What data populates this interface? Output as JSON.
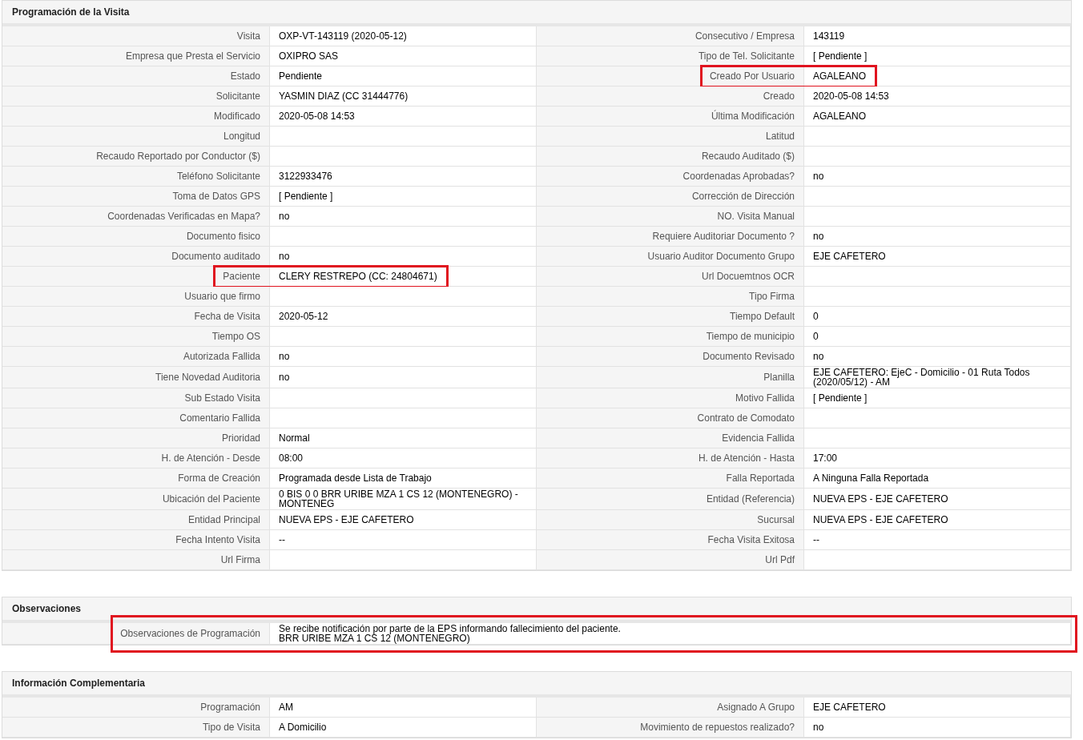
{
  "sections": [
    {
      "title": "Programación de la Visita",
      "kind": "grid",
      "rows": [
        [
          {
            "label": "Visita",
            "value": "OXP-VT-143119 (2020-05-12)",
            "highlighted": false
          },
          {
            "label": "Consecutivo / Empresa",
            "value": "143119",
            "highlighted": false
          }
        ],
        [
          {
            "label": "Empresa que Presta el Servicio",
            "value": "OXIPRO SAS",
            "highlighted": false
          },
          {
            "label": "Tipo de Tel. Solicitante",
            "value": "[ Pendiente ]",
            "highlighted": false
          }
        ],
        [
          {
            "label": "Estado",
            "value": "Pendiente",
            "highlighted": false
          },
          {
            "label": "Creado Por Usuario",
            "value": "AGALEANO",
            "highlighted": true
          }
        ],
        [
          {
            "label": "Solicitante",
            "value": "YASMIN DIAZ (CC 31444776)",
            "highlighted": false
          },
          {
            "label": "Creado",
            "value": "2020-05-08 14:53",
            "highlighted": false
          }
        ],
        [
          {
            "label": "Modificado",
            "value": "2020-05-08 14:53",
            "highlighted": false
          },
          {
            "label": "Última Modificación",
            "value": "AGALEANO",
            "highlighted": false
          }
        ],
        [
          {
            "label": "Longitud",
            "highlighted": false
          },
          {
            "label": "Latitud",
            "highlighted": false
          }
        ],
        [
          {
            "label": "Recaudo Reportado por Conductor ($)",
            "highlighted": false
          },
          {
            "label": "Recaudo Auditado ($)",
            "highlighted": false
          }
        ],
        [
          {
            "label": "Teléfono Solicitante",
            "value": "3122933476",
            "highlighted": false
          },
          {
            "label": "Coordenadas Aprobadas?",
            "value": "no",
            "highlighted": false
          }
        ],
        [
          {
            "label": "Toma de Datos GPS",
            "value": "[ Pendiente ]",
            "highlighted": false
          },
          {
            "label": "Corrección de Dirección",
            "highlighted": false
          }
        ],
        [
          {
            "label": "Coordenadas Verificadas en Mapa?",
            "value": "no",
            "highlighted": false
          },
          {
            "label": "NO. Visita Manual",
            "highlighted": false
          }
        ],
        [
          {
            "label": "Documento fisico",
            "highlighted": false
          },
          {
            "label": "Requiere Auditoriar Documento ?",
            "value": "no",
            "highlighted": false
          }
        ],
        [
          {
            "label": "Documento auditado",
            "value": "no",
            "highlighted": false
          },
          {
            "label": "Usuario Auditor Documento Grupo",
            "value": "EJE CAFETERO",
            "highlighted": false
          }
        ],
        [
          {
            "label": "Paciente",
            "value": "CLERY RESTREPO (CC: 24804671)",
            "highlighted": true
          },
          {
            "label": "Url Docuemtnos OCR",
            "highlighted": false
          }
        ],
        [
          {
            "label": "Usuario que firmo",
            "highlighted": false
          },
          {
            "label": "Tipo Firma",
            "highlighted": false
          }
        ],
        [
          {
            "label": "Fecha de Visita",
            "value": "2020-05-12",
            "highlighted": false
          },
          {
            "label": "Tiempo Default",
            "value": "0",
            "highlighted": false
          }
        ],
        [
          {
            "label": "Tiempo OS",
            "highlighted": false
          },
          {
            "label": "Tiempo de municipio",
            "value": "0",
            "highlighted": false
          }
        ],
        [
          {
            "label": "Autorizada Fallida",
            "value": "no",
            "highlighted": false
          },
          {
            "label": "Documento Revisado",
            "value": "no",
            "highlighted": false
          }
        ],
        [
          {
            "label": "Tiene Novedad Auditoria",
            "value": "no",
            "highlighted": false
          },
          {
            "label": "Planilla",
            "value": "EJE CAFETERO: EjeC - Domicilio - 01 Ruta Todos (2020/05/12) - AM",
            "highlighted": false
          }
        ],
        [
          {
            "label": "Sub Estado Visita",
            "highlighted": false
          },
          {
            "label": "Motivo Fallida",
            "value": "[ Pendiente ]",
            "highlighted": false
          }
        ],
        [
          {
            "label": "Comentario Fallida",
            "highlighted": false
          },
          {
            "label": "Contrato de Comodato",
            "highlighted": false
          }
        ],
        [
          {
            "label": "Prioridad",
            "value": "Normal",
            "highlighted": false
          },
          {
            "label": "Evidencia Fallida",
            "highlighted": false
          }
        ],
        [
          {
            "label": "H. de Atención - Desde",
            "value": "08:00",
            "highlighted": false
          },
          {
            "label": "H. de Atención - Hasta",
            "value": "17:00",
            "highlighted": false
          }
        ],
        [
          {
            "label": "Forma de Creación",
            "value": "Programada desde Lista de Trabajo",
            "highlighted": false
          },
          {
            "label": "Falla Reportada",
            "value": "A Ninguna Falla Reportada",
            "highlighted": false
          }
        ],
        [
          {
            "label": "Ubicación del Paciente",
            "value": "0 BIS 0 0 BRR URIBE MZA 1 CS 12 (MONTENEGRO) - MONTENEG",
            "highlighted": false
          },
          {
            "label": "Entidad (Referencia)",
            "value": "NUEVA EPS - EJE CAFETERO",
            "highlighted": false
          }
        ],
        [
          {
            "label": "Entidad Principal",
            "value": "NUEVA EPS - EJE CAFETERO",
            "highlighted": false
          },
          {
            "label": "Sucursal",
            "value": "NUEVA EPS - EJE CAFETERO",
            "highlighted": false
          }
        ],
        [
          {
            "label": "Fecha Intento Visita",
            "value": "--",
            "highlighted": false
          },
          {
            "label": "Fecha Visita Exitosa",
            "value": "--",
            "highlighted": false
          }
        ],
        [
          {
            "label": "Url Firma",
            "highlighted": false
          },
          {
            "label": "Url Pdf",
            "highlighted": false
          }
        ]
      ]
    },
    {
      "title": "Observaciones",
      "kind": "wide",
      "rows": [
        [
          {
            "label": "Observaciones de Programación",
            "value": "Se recibe notificación por parte de la EPS informando fallecimiento del paciente.\nBRR URIBE MZA 1 CS 12 (MONTENEGRO)",
            "highlighted": true
          }
        ]
      ]
    },
    {
      "title": "Información Complementaria",
      "kind": "grid",
      "rows": [
        [
          {
            "label": "Programación",
            "value": "AM",
            "highlighted": false
          },
          {
            "label": "Asignado A Grupo",
            "value": "EJE CAFETERO",
            "highlighted": false
          }
        ],
        [
          {
            "label": "Tipo de Visita",
            "value": "A Domicilio",
            "highlighted": false
          },
          {
            "label": "Movimiento de repuestos realizado?",
            "value": "no",
            "highlighted": false
          }
        ]
      ]
    }
  ]
}
